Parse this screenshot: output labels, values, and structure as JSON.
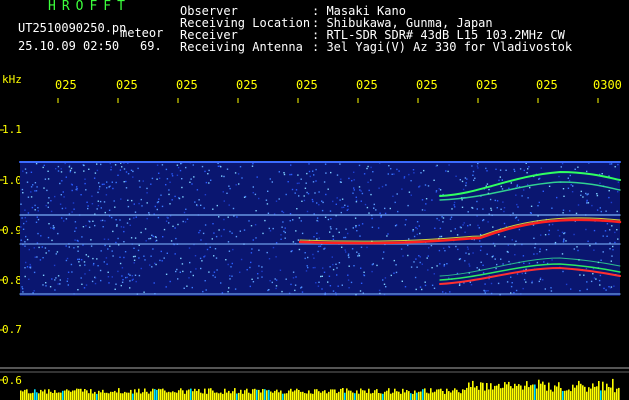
{
  "header": {
    "brand": "HROFFT",
    "file_name": "UT2510090250.pn",
    "file_suffix": "meteor",
    "date_time": "25.10.09 02:50",
    "count": "69.",
    "observer_label": "Observer",
    "observer_value": ": Masaki Kano",
    "location_label": "Receiving Location",
    "location_value": ": Shibukawa, Gunma, Japan",
    "receiver_label": "Receiver",
    "receiver_value": ": RTL-SDR SDR# 43dB L15 103.2MHz CW",
    "antenna_label": "Receiving Antenna",
    "antenna_value": ": 3el Yagi(V) Az 330 for Vladivostok"
  },
  "axis": {
    "unit": "kHz",
    "x_ticks": [
      "025",
      "025",
      "025",
      "025",
      "025",
      "025",
      "025",
      "025",
      "025",
      "0300"
    ],
    "y_ticks": [
      "1.1",
      "1.0",
      "0.9",
      "0.8",
      "0.7",
      "0.6"
    ]
  },
  "colors": {
    "background": "#000000",
    "header_green": "#3cff3c",
    "axis_yellow": "#ffff00",
    "noise_blue": "#1a3cff",
    "signal_red": "#ff2020"
  }
}
